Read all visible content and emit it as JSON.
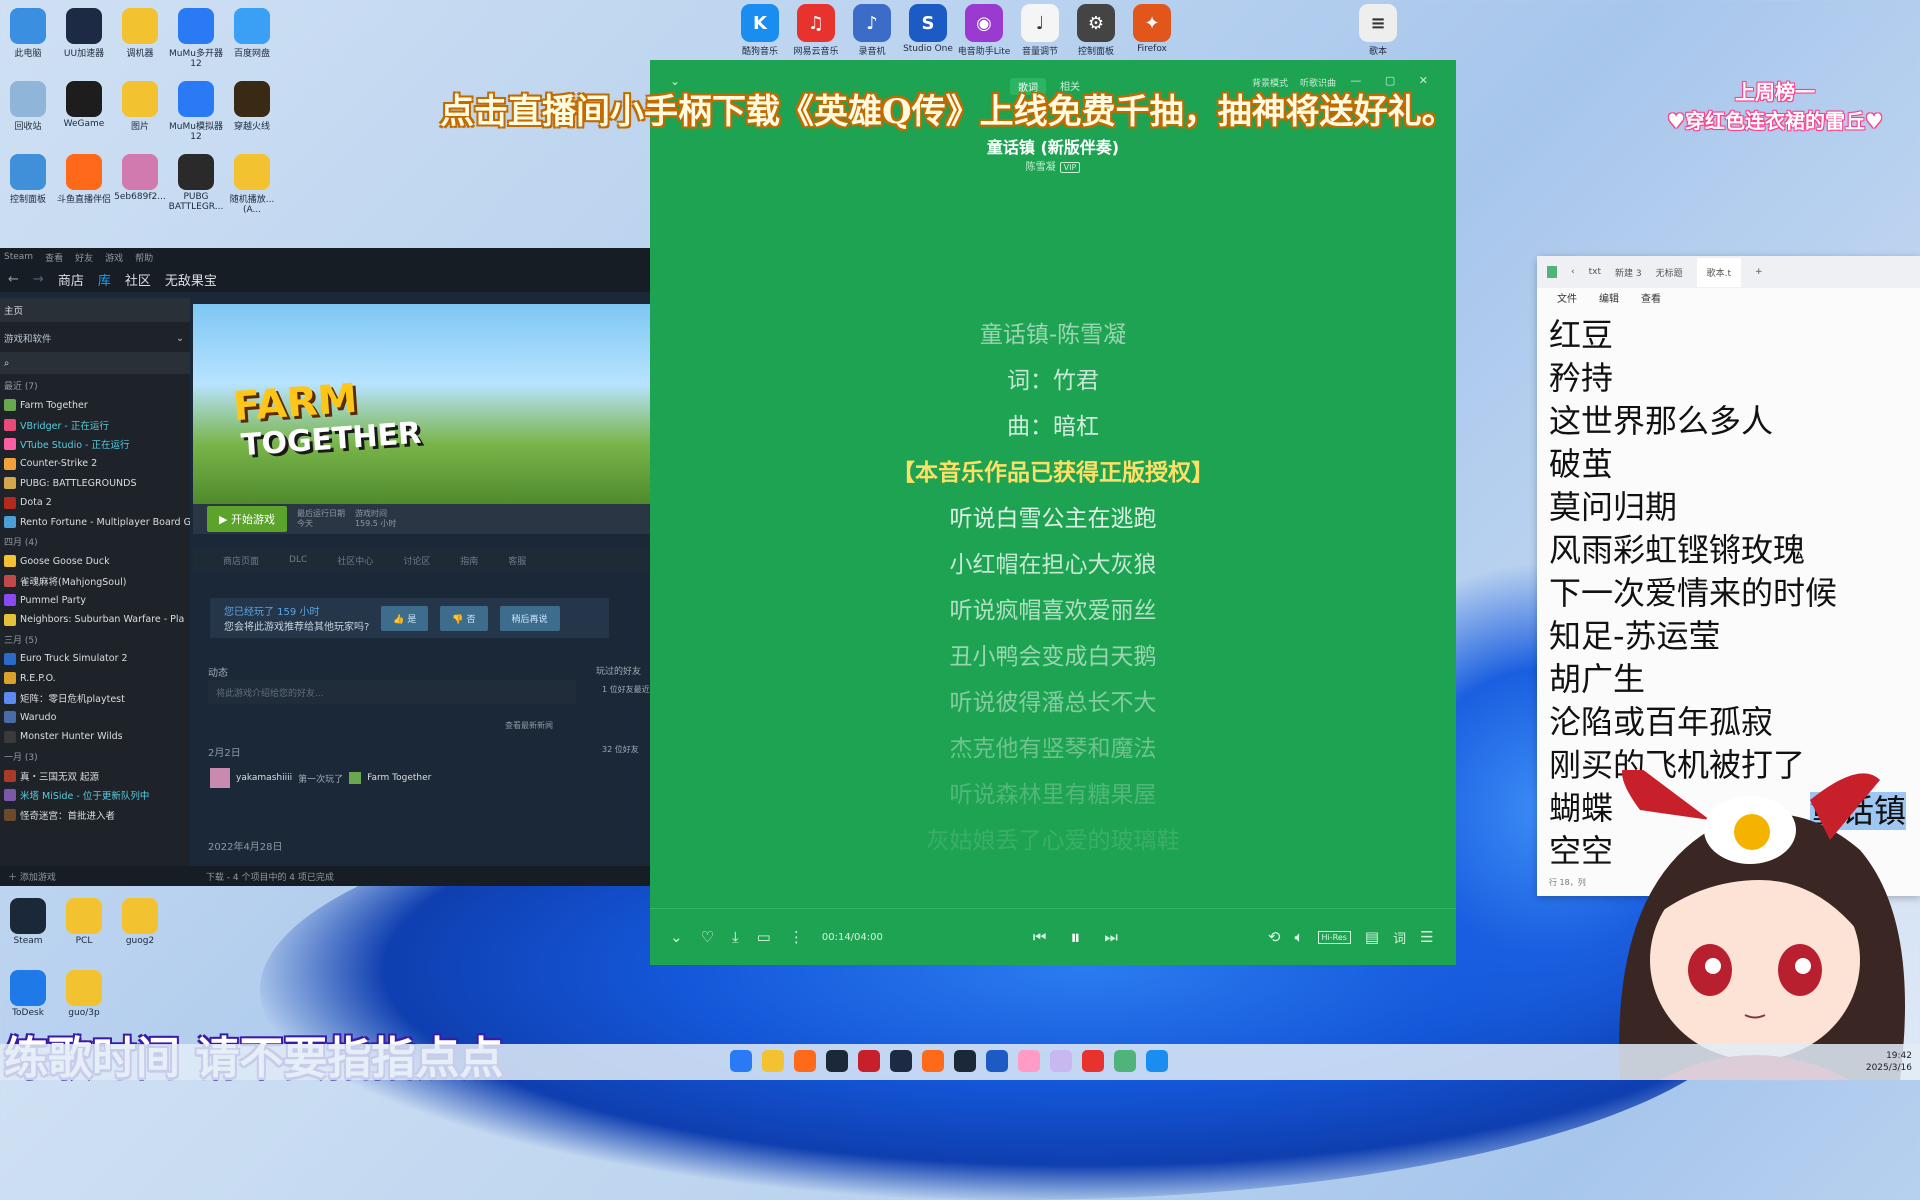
{
  "desktop": {
    "left_icons": [
      {
        "label": "此电脑",
        "color": "#3b8fe0"
      },
      {
        "label": "UU加速器",
        "color": "#1c2a44"
      },
      {
        "label": "调机器",
        "color": "#f2c230"
      },
      {
        "label": "MuMu多开器12",
        "color": "#2a7af5"
      },
      {
        "label": "百度网盘",
        "color": "#3aa0f5"
      },
      {
        "label": "回收站",
        "color": "#8fb5d9"
      },
      {
        "label": "WeGame",
        "color": "#1d1d1d"
      },
      {
        "label": "图片",
        "color": "#f2c230"
      },
      {
        "label": "MuMu模拟器12",
        "color": "#2a7af5"
      },
      {
        "label": "穿越火线",
        "color": "#3a2a14"
      },
      {
        "label": "控制面板",
        "color": "#3f8fd9"
      },
      {
        "label": "斗鱼直播伴侣",
        "color": "#ff6a1a"
      },
      {
        "label": "5eb689f2...",
        "color": "#d07ab0"
      },
      {
        "label": "PUBG BATTLEGR...",
        "color": "#2a2a2a"
      },
      {
        "label": "随机播放...(A...",
        "color": "#f2c230"
      }
    ],
    "bottom_icons": [
      {
        "label": "Steam",
        "color": "#1b2838"
      },
      {
        "label": "PCL",
        "color": "#f2c230"
      },
      {
        "label": "guog2",
        "color": "#f2c230"
      },
      {
        "label": "ToDesk",
        "color": "#1f7ae8"
      },
      {
        "label": "guo/3p",
        "color": "#f2c230"
      }
    ],
    "top_icons": [
      {
        "label": "酷狗音乐",
        "color": "#1a8df0",
        "glyph": "K"
      },
      {
        "label": "网易云音乐",
        "color": "#e8322d",
        "glyph": "♫"
      },
      {
        "label": "录音机",
        "color": "#3a6cc8",
        "glyph": "♪"
      },
      {
        "label": "Studio One",
        "color": "#1d5bc4",
        "glyph": "S"
      },
      {
        "label": "电音助手Lite",
        "color": "#9a3ad0",
        "glyph": "◉"
      },
      {
        "label": "音量调节",
        "color": "#f5f5f5",
        "glyph": "♩"
      },
      {
        "label": "控制面板",
        "color": "#444",
        "glyph": "⚙"
      },
      {
        "label": "Firefox",
        "color": "#e2561b",
        "glyph": "✦"
      },
      {
        "label": "歌本",
        "color": "#eeeeee",
        "glyph": "≡"
      }
    ]
  },
  "overlay": {
    "banner": "点击直播间小手柄下载《英雄Q传》上线免费千抽，抽神将送好礼。",
    "rank_title": "上周榜一",
    "rank_name": "♥穿红色连衣裙的雷丘♥",
    "subtitle": "练歌时间 请不要指指点点"
  },
  "steam": {
    "menu": [
      "Steam",
      "查看",
      "好友",
      "游戏",
      "帮助"
    ],
    "nav": [
      "商店",
      "库",
      "社区",
      "无敌果宝"
    ],
    "nav_active": 1,
    "home": "主页",
    "filter": "游戏和软件",
    "sections": [
      {
        "header": "最近 (7)",
        "games": [
          {
            "name": "Farm Together",
            "running": false,
            "color": "#6aa84f"
          },
          {
            "name": "VBridger - 正在运行",
            "running": true,
            "color": "#e84a7a"
          },
          {
            "name": "VTube Studio - 正在运行",
            "running": true,
            "color": "#ff5fa2"
          },
          {
            "name": "Counter-Strike 2",
            "running": false,
            "color": "#f2a23a"
          },
          {
            "name": "PUBG: BATTLEGROUNDS",
            "running": false,
            "color": "#d4a84a"
          },
          {
            "name": "Dota 2",
            "running": false,
            "color": "#b52a1e"
          },
          {
            "name": "Rento Fortune - Multiplayer Board G",
            "running": false,
            "color": "#4a9fd6"
          }
        ]
      },
      {
        "header": "四月 (4)",
        "games": [
          {
            "name": "Goose Goose Duck",
            "running": false,
            "color": "#f2c230"
          },
          {
            "name": "雀魂麻将(MahjongSoul)",
            "running": false,
            "color": "#c04a4a"
          },
          {
            "name": "Pummel Party",
            "running": false,
            "color": "#8a4af2"
          },
          {
            "name": "Neighbors: Suburban Warfare - Pla",
            "running": false,
            "color": "#e2c23a"
          }
        ]
      },
      {
        "header": "三月 (5)",
        "games": [
          {
            "name": "Euro Truck Simulator 2",
            "running": false,
            "color": "#2a6ac8"
          },
          {
            "name": "R.E.P.O.",
            "running": false,
            "color": "#d9a22a"
          },
          {
            "name": "矩阵：零日危机playtest",
            "running": false,
            "color": "#5a8af2"
          },
          {
            "name": "Warudo",
            "running": false,
            "color": "#4a6aa8"
          },
          {
            "name": "Monster Hunter Wilds",
            "running": false,
            "color": "#3a3a3a"
          }
        ]
      },
      {
        "header": "一月 (3)",
        "games": [
          {
            "name": "真・三国无双 起源",
            "running": false,
            "color": "#a83a2a"
          },
          {
            "name": "米塔 MiSide - 位于更新队列中",
            "running": true,
            "color": "#7a5aa8"
          },
          {
            "name": "怪奇迷宫：首批进入者",
            "running": false,
            "color": "#6a4a2a"
          }
        ]
      }
    ],
    "add_game": "添加游戏",
    "game_title_line1": "FARM",
    "game_title_line2": "TOGETHER",
    "play_button": "开始游戏",
    "last_run_label": "最后运行日期",
    "last_run_value": "今天",
    "play_time_label": "游戏时间",
    "play_time_value": "159.5 小时",
    "sub_tabs": [
      "商店页面",
      "DLC",
      "社区中心",
      "讨论区",
      "指南",
      "客服"
    ],
    "review_q1": "您已经玩了 159 小时",
    "review_q2": "您会将此游戏推荐给其他玩家吗?",
    "review_yes": "是",
    "review_no": "否",
    "review_later": "稍后再说",
    "activity_label": "动态",
    "activity_placeholder": "将此游戏介绍给您的好友...",
    "friends_label": "玩过的好友",
    "friends_count1": "1 位好友最近",
    "friends_count2": "32 位好友",
    "view_news": "查看最新新闻",
    "date1": "2月2日",
    "activity_user": "yakamashiiii",
    "activity_text": "第一次玩了",
    "activity_game": "Farm Together",
    "date2": "2022年4月28日",
    "download_status": "下载 - 4 个项目中的 4 项已完成"
  },
  "player": {
    "tabs": [
      "歌词",
      "相关"
    ],
    "tab_active": 0,
    "mode": "背景模式",
    "listen": "听歌识曲",
    "song": "童话镇 (新版伴奏)",
    "artist": "陈雪凝",
    "vip": "VIP",
    "lyrics": [
      {
        "text": "童话镇-陈雪凝",
        "op": 0.55,
        "hl": false
      },
      {
        "text": "词：竹君",
        "op": 0.75,
        "hl": false
      },
      {
        "text": "曲：暗杠",
        "op": 0.8,
        "hl": false
      },
      {
        "text": "【本音乐作品已获得正版授权】",
        "op": 1,
        "hl": true
      },
      {
        "text": "听说白雪公主在逃跑",
        "op": 0.85,
        "hl": false
      },
      {
        "text": "小红帽在担心大灰狼",
        "op": 0.75,
        "hl": false
      },
      {
        "text": "听说疯帽喜欢爱丽丝",
        "op": 0.65,
        "hl": false
      },
      {
        "text": "丑小鸭会变成白天鹅",
        "op": 0.55,
        "hl": false
      },
      {
        "text": "听说彼得潘总长不大",
        "op": 0.45,
        "hl": false
      },
      {
        "text": "杰克他有竖琴和魔法",
        "op": 0.35,
        "hl": false
      },
      {
        "text": "听说森林里有糖果屋",
        "op": 0.22,
        "hl": false
      },
      {
        "text": "灰姑娘丢了心爱的玻璃鞋",
        "op": 0.12,
        "hl": false
      }
    ],
    "time": "00:14/04:00",
    "quality": "Hi-Res",
    "lyric_btn": "词"
  },
  "notepad": {
    "tabs": [
      "txt",
      "新建 3",
      "无标题",
      "歌本.t"
    ],
    "active_tab": 3,
    "menu": [
      "文件",
      "编辑",
      "查看"
    ],
    "lines": [
      "红豆",
      "矜持",
      "这世界那么多人",
      "破茧",
      "莫问归期",
      "风雨彩虹铿锵玫瑰",
      "下一次爱情来的时候",
      "知足-苏运莹",
      "胡广生",
      "沦陷或百年孤寂",
      "刚买的飞机被打了",
      "蝴蝶",
      "空空"
    ],
    "selected": "童话镇",
    "status": "行 18，列"
  },
  "taskbar": {
    "time": "19:42",
    "date": "2025/3/16"
  }
}
